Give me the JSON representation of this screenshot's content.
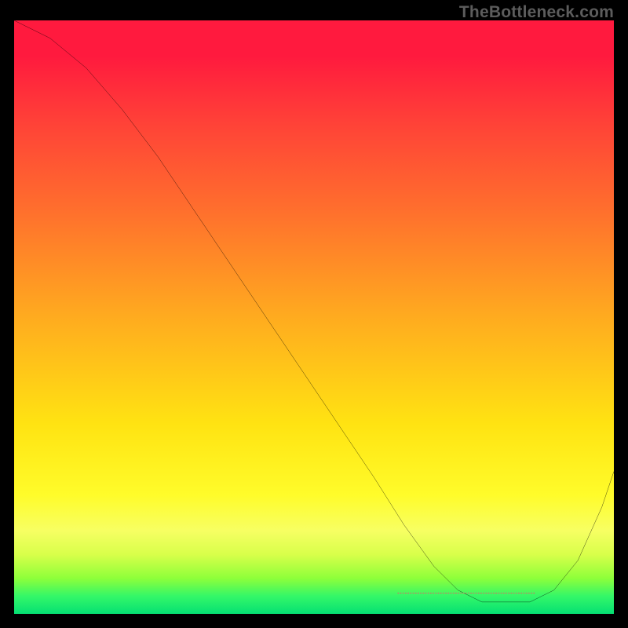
{
  "watermark": "TheBottleneck.com",
  "chart_data": {
    "type": "line",
    "title": "",
    "xlabel": "",
    "ylabel": "",
    "xlim": [
      0,
      100
    ],
    "ylim": [
      0,
      100
    ],
    "series": [
      {
        "name": "curve",
        "x": [
          0,
          6,
          12,
          18,
          24,
          30,
          36,
          42,
          48,
          54,
          60,
          65,
          70,
          74,
          78,
          82,
          86,
          90,
          94,
          98,
          100
        ],
        "y": [
          100,
          97,
          92,
          85,
          77,
          68,
          59,
          50,
          41,
          32,
          23,
          15,
          8,
          4,
          2,
          2,
          2,
          4,
          9,
          18,
          24
        ]
      }
    ],
    "annotations": [
      {
        "name": "valley-marker",
        "type": "dashed-segment",
        "color": "#d86a66",
        "x": [
          64,
          87
        ],
        "y": [
          3.5,
          3.5
        ]
      }
    ],
    "background_gradient": {
      "top": "#ff1a3e",
      "mid": "#ffe312",
      "bottom": "#05e073"
    }
  }
}
